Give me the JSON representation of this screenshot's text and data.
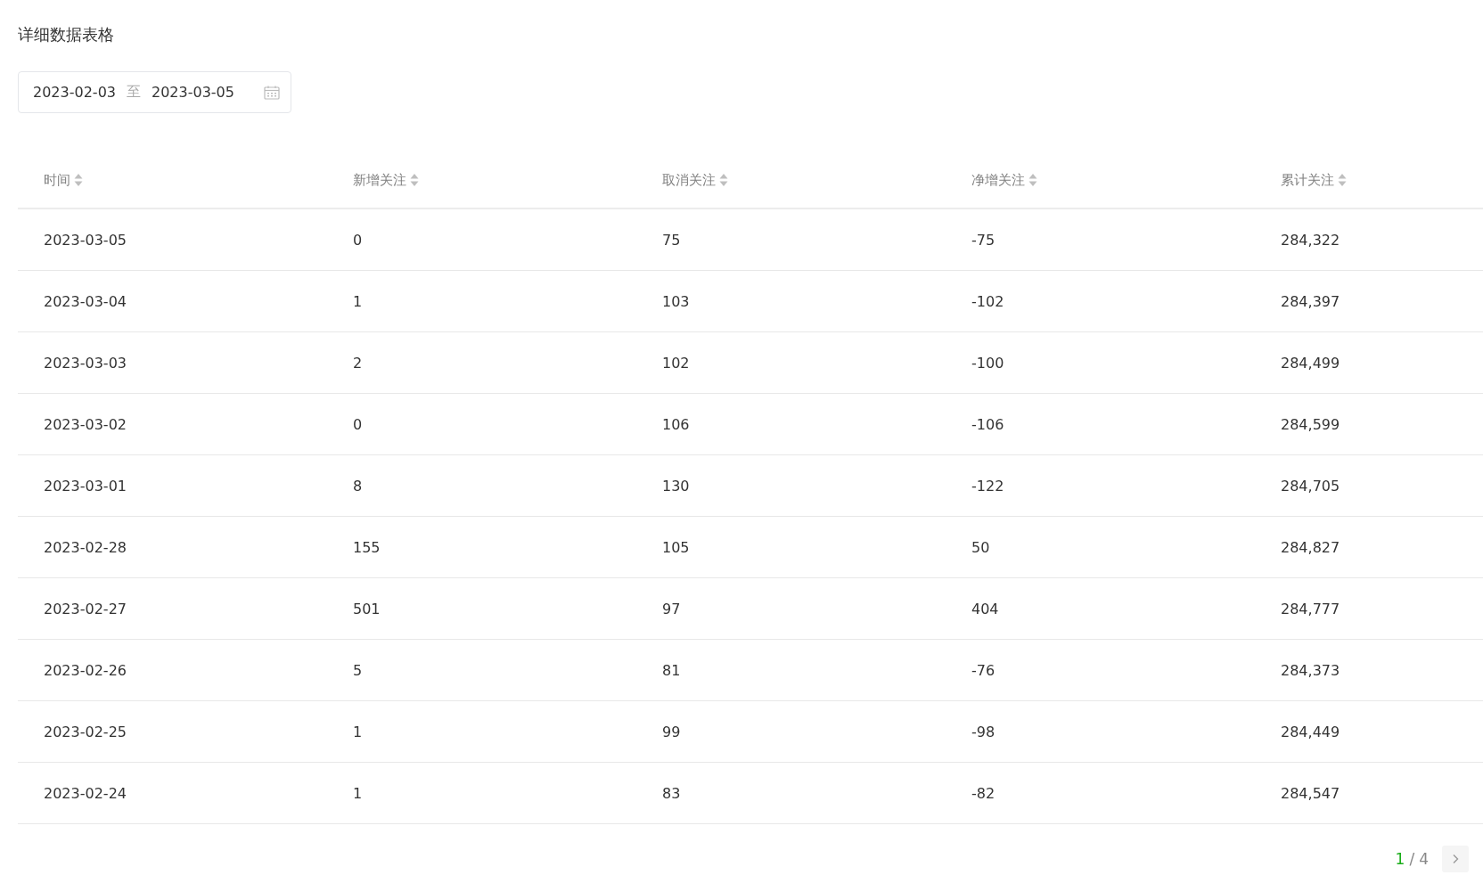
{
  "title": "详细数据表格",
  "date_range": {
    "start": "2023-02-03",
    "separator": "至",
    "end": "2023-03-05"
  },
  "table": {
    "columns": [
      {
        "label": "时间"
      },
      {
        "label": "新增关注"
      },
      {
        "label": "取消关注"
      },
      {
        "label": "净增关注"
      },
      {
        "label": "累计关注"
      }
    ],
    "rows": [
      {
        "cells": [
          "2023-03-05",
          "0",
          "75",
          "-75",
          "284,322"
        ]
      },
      {
        "cells": [
          "2023-03-04",
          "1",
          "103",
          "-102",
          "284,397"
        ]
      },
      {
        "cells": [
          "2023-03-03",
          "2",
          "102",
          "-100",
          "284,499"
        ]
      },
      {
        "cells": [
          "2023-03-02",
          "0",
          "106",
          "-106",
          "284,599"
        ]
      },
      {
        "cells": [
          "2023-03-01",
          "8",
          "130",
          "-122",
          "284,705"
        ]
      },
      {
        "cells": [
          "2023-02-28",
          "155",
          "105",
          "50",
          "284,827"
        ]
      },
      {
        "cells": [
          "2023-02-27",
          "501",
          "97",
          "404",
          "284,777"
        ]
      },
      {
        "cells": [
          "2023-02-26",
          "5",
          "81",
          "-76",
          "284,373"
        ]
      },
      {
        "cells": [
          "2023-02-25",
          "1",
          "99",
          "-98",
          "284,449"
        ]
      },
      {
        "cells": [
          "2023-02-24",
          "1",
          "83",
          "-82",
          "284,547"
        ]
      }
    ]
  },
  "pagination": {
    "current": "1",
    "separator": "/",
    "total": "4"
  }
}
